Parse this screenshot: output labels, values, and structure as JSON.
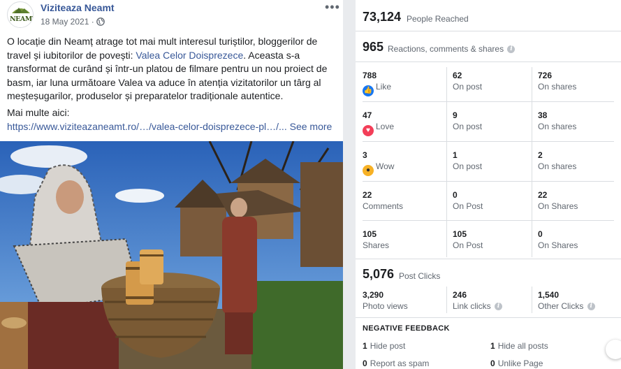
{
  "post": {
    "page_name": "Viziteaza Neamt",
    "date": "18 May 2021 ·",
    "avatar_text": "NEAMT",
    "text_before_link": "O locație din Neamț atrage tot mai mult interesul turiștilor, bloggerilor de travel și iubitorilor de povești: ",
    "text_link": "Valea Celor Doisprezece",
    "text_after_link": ". Aceasta s-a transformat de curând și într-un platou de filmare pentru un nou proiect de basm, iar luna următoare Valea va aduce în atenția vizitatorilor un târg al meșteșugarilor, produselor și preparatelor tradiționale autentice.",
    "more_label": "Mai multe aici:",
    "url": "https://www.viziteazaneamt.ro/…/valea-celor-doisprezece-pl…/...",
    "see_more": "See more"
  },
  "insights": {
    "reached_value": "73,124",
    "reached_label": "People Reached",
    "reactions_value": "965",
    "reactions_label": "Reactions, comments & shares",
    "rows": [
      {
        "total": "788",
        "total_label": "Like",
        "on_post": "62",
        "on_post_label": "On post",
        "on_shares": "726",
        "on_shares_label": "On shares"
      },
      {
        "total": "47",
        "total_label": "Love",
        "on_post": "9",
        "on_post_label": "On post",
        "on_shares": "38",
        "on_shares_label": "On shares"
      },
      {
        "total": "3",
        "total_label": "Wow",
        "on_post": "1",
        "on_post_label": "On post",
        "on_shares": "2",
        "on_shares_label": "On shares"
      },
      {
        "total": "22",
        "total_label": "Comments",
        "on_post": "0",
        "on_post_label": "On Post",
        "on_shares": "22",
        "on_shares_label": "On Shares"
      },
      {
        "total": "105",
        "total_label": "Shares",
        "on_post": "105",
        "on_post_label": "On Post",
        "on_shares": "0",
        "on_shares_label": "On Shares"
      }
    ],
    "clicks_value": "5,076",
    "clicks_label": "Post Clicks",
    "clicks": [
      {
        "value": "3,290",
        "label": "Photo views"
      },
      {
        "value": "246",
        "label": "Link clicks"
      },
      {
        "value": "1,540",
        "label": "Other Clicks"
      }
    ],
    "negative_title": "NEGATIVE FEEDBACK",
    "negative": [
      {
        "value": "1",
        "label": "Hide post"
      },
      {
        "value": "1",
        "label": "Hide all posts"
      },
      {
        "value": "0",
        "label": "Report as spam"
      },
      {
        "value": "0",
        "label": "Unlike Page"
      }
    ]
  },
  "colors": {
    "link": "#385898",
    "like": "#1877f2",
    "love": "#f33e58",
    "wow": "#f7b125"
  }
}
